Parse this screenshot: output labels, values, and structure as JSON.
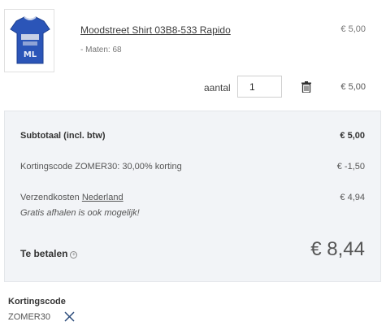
{
  "item": {
    "title": "Moodstreet Shirt 03B8-533 Rapido",
    "unit_price": "€ 5,00",
    "size": "- Maten: 68",
    "qty_label": "aantal",
    "qty_value": "1",
    "line_total": "€ 5,00",
    "thumbnail_icon": "tshirt-image",
    "shirt_print_text": "ML"
  },
  "summary": {
    "subtotal_label": "Subtotaal (incl. btw)",
    "subtotal_value": "€ 5,00",
    "discount_label": "Kortingscode ZOMER30: 30,00% korting",
    "discount_value": "€ -1,50",
    "shipping_label_prefix": "Verzendkosten",
    "shipping_country": "Nederland",
    "shipping_value": "€ 4,94",
    "pickup_note": "Gratis afhalen is ook mogelijk!",
    "total_label": "Te betalen",
    "total_value": "€ 8,44"
  },
  "coupon": {
    "title": "Kortingscode",
    "code": "ZOMER30"
  },
  "colors": {
    "summary_bg": "#f2f4f7",
    "shirt_blue": "#2b55b8"
  }
}
